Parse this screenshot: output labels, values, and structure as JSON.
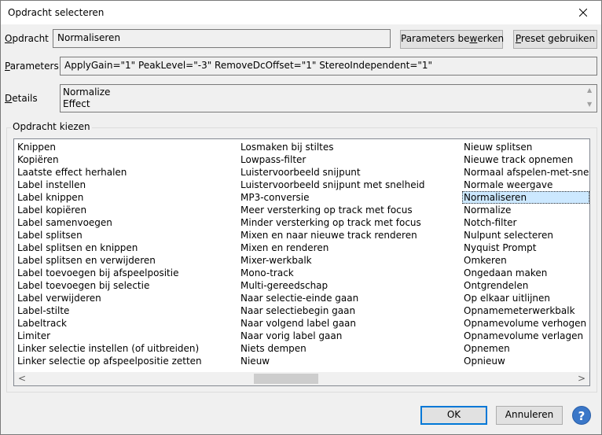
{
  "window": {
    "title": "Opdracht selecteren"
  },
  "command": {
    "label": "Opdracht",
    "value": "Normaliseren",
    "params_button": "Parameters bewerken",
    "preset_button": "Preset gebruiken"
  },
  "parameters": {
    "label": "Parameters",
    "value": "ApplyGain=\"1\" PeakLevel=\"-3\" RemoveDcOffset=\"1\" StereoIndependent=\"1\""
  },
  "details": {
    "label": "Details",
    "lines": [
      "Normalize",
      "Effect"
    ]
  },
  "choose": {
    "label": "Opdracht kiezen",
    "columns": [
      [
        "Knippen",
        "Kopiëren",
        "Laatste effect herhalen",
        "Label instellen",
        "Label knippen",
        "Label kopiëren",
        "Label samenvoegen",
        "Label splitsen",
        "Label splitsen en knippen",
        "Label splitsen en verwijderen",
        "Label toevoegen bij afspeelpositie",
        "Label toevoegen bij selectie",
        "Label verwijderen",
        "Label-stilte",
        "Labeltrack",
        "Limiter",
        "Linker selectie instellen (of uitbreiden)",
        "Linker selectie op afspeelpositie zetten"
      ],
      [
        "Losmaken bij stiltes",
        "Lowpass-filter",
        "Luistervoorbeeld snijpunt",
        "Luistervoorbeeld snijpunt met snelheid",
        "MP3-conversie",
        "Meer versterking op track met focus",
        "Minder versterking op track met focus",
        "Mixen en naar nieuwe track renderen",
        "Mixen en renderen",
        "Mixer-werkbalk",
        "Mono-track",
        "Multi-gereedschap",
        "Naar selectie-einde gaan",
        "Naar selectiebegin gaan",
        "Naar volgend label gaan",
        "Naar vorig label gaan",
        "Niets dempen",
        "Nieuw"
      ],
      [
        "Nieuw splitsen",
        "Nieuwe track opnemen",
        "Normaal afspelen-met-snelheid",
        "Normale weergave",
        "Normaliseren",
        "Normalize",
        "Notch-filter",
        "Nulpunt selecteren",
        "Nyquist Prompt",
        "Omkeren",
        "Ongedaan maken",
        "Ontgrendelen",
        "Op elkaar uitlijnen",
        "Opnamemeterwerkbalk",
        "Opnamevolume verhogen",
        "Opnamevolume verlagen",
        "Opnemen",
        "Opnieuw"
      ]
    ],
    "selected": "Normaliseren"
  },
  "footer": {
    "ok": "OK",
    "cancel": "Annuleren",
    "help": "?"
  },
  "colors": {
    "accent": "#0078d7",
    "selection": "#cce8ff",
    "help": "#3a77c8"
  }
}
